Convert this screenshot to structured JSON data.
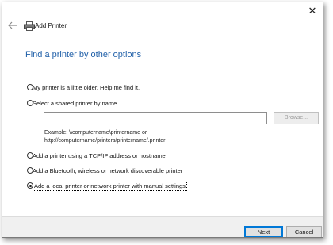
{
  "window": {
    "title": "Add Printer",
    "close_glyph": "✕"
  },
  "page": {
    "heading": "Find a printer by other options"
  },
  "options": [
    {
      "label": "My printer is a little older. Help me find it.",
      "checked": false
    },
    {
      "label": "Select a shared printer by name",
      "checked": false
    },
    {
      "label": "Add a printer using a TCP/IP address or hostname",
      "checked": false
    },
    {
      "label": "Add a Bluetooth, wireless or network discoverable printer",
      "checked": false
    },
    {
      "label": "Add a local printer or network printer with manual settings",
      "checked": true
    }
  ],
  "shared": {
    "value": "",
    "browse_label": "Browse...",
    "example_line1": "Example: \\\\computername\\printername or",
    "example_line2": "http://computername/printers/printername/.printer"
  },
  "buttons": {
    "next": "Next",
    "cancel": "Cancel"
  },
  "colors": {
    "heading": "#1f5fa8",
    "accent": "#0078d7",
    "footer_bg": "#f0f0f0"
  }
}
